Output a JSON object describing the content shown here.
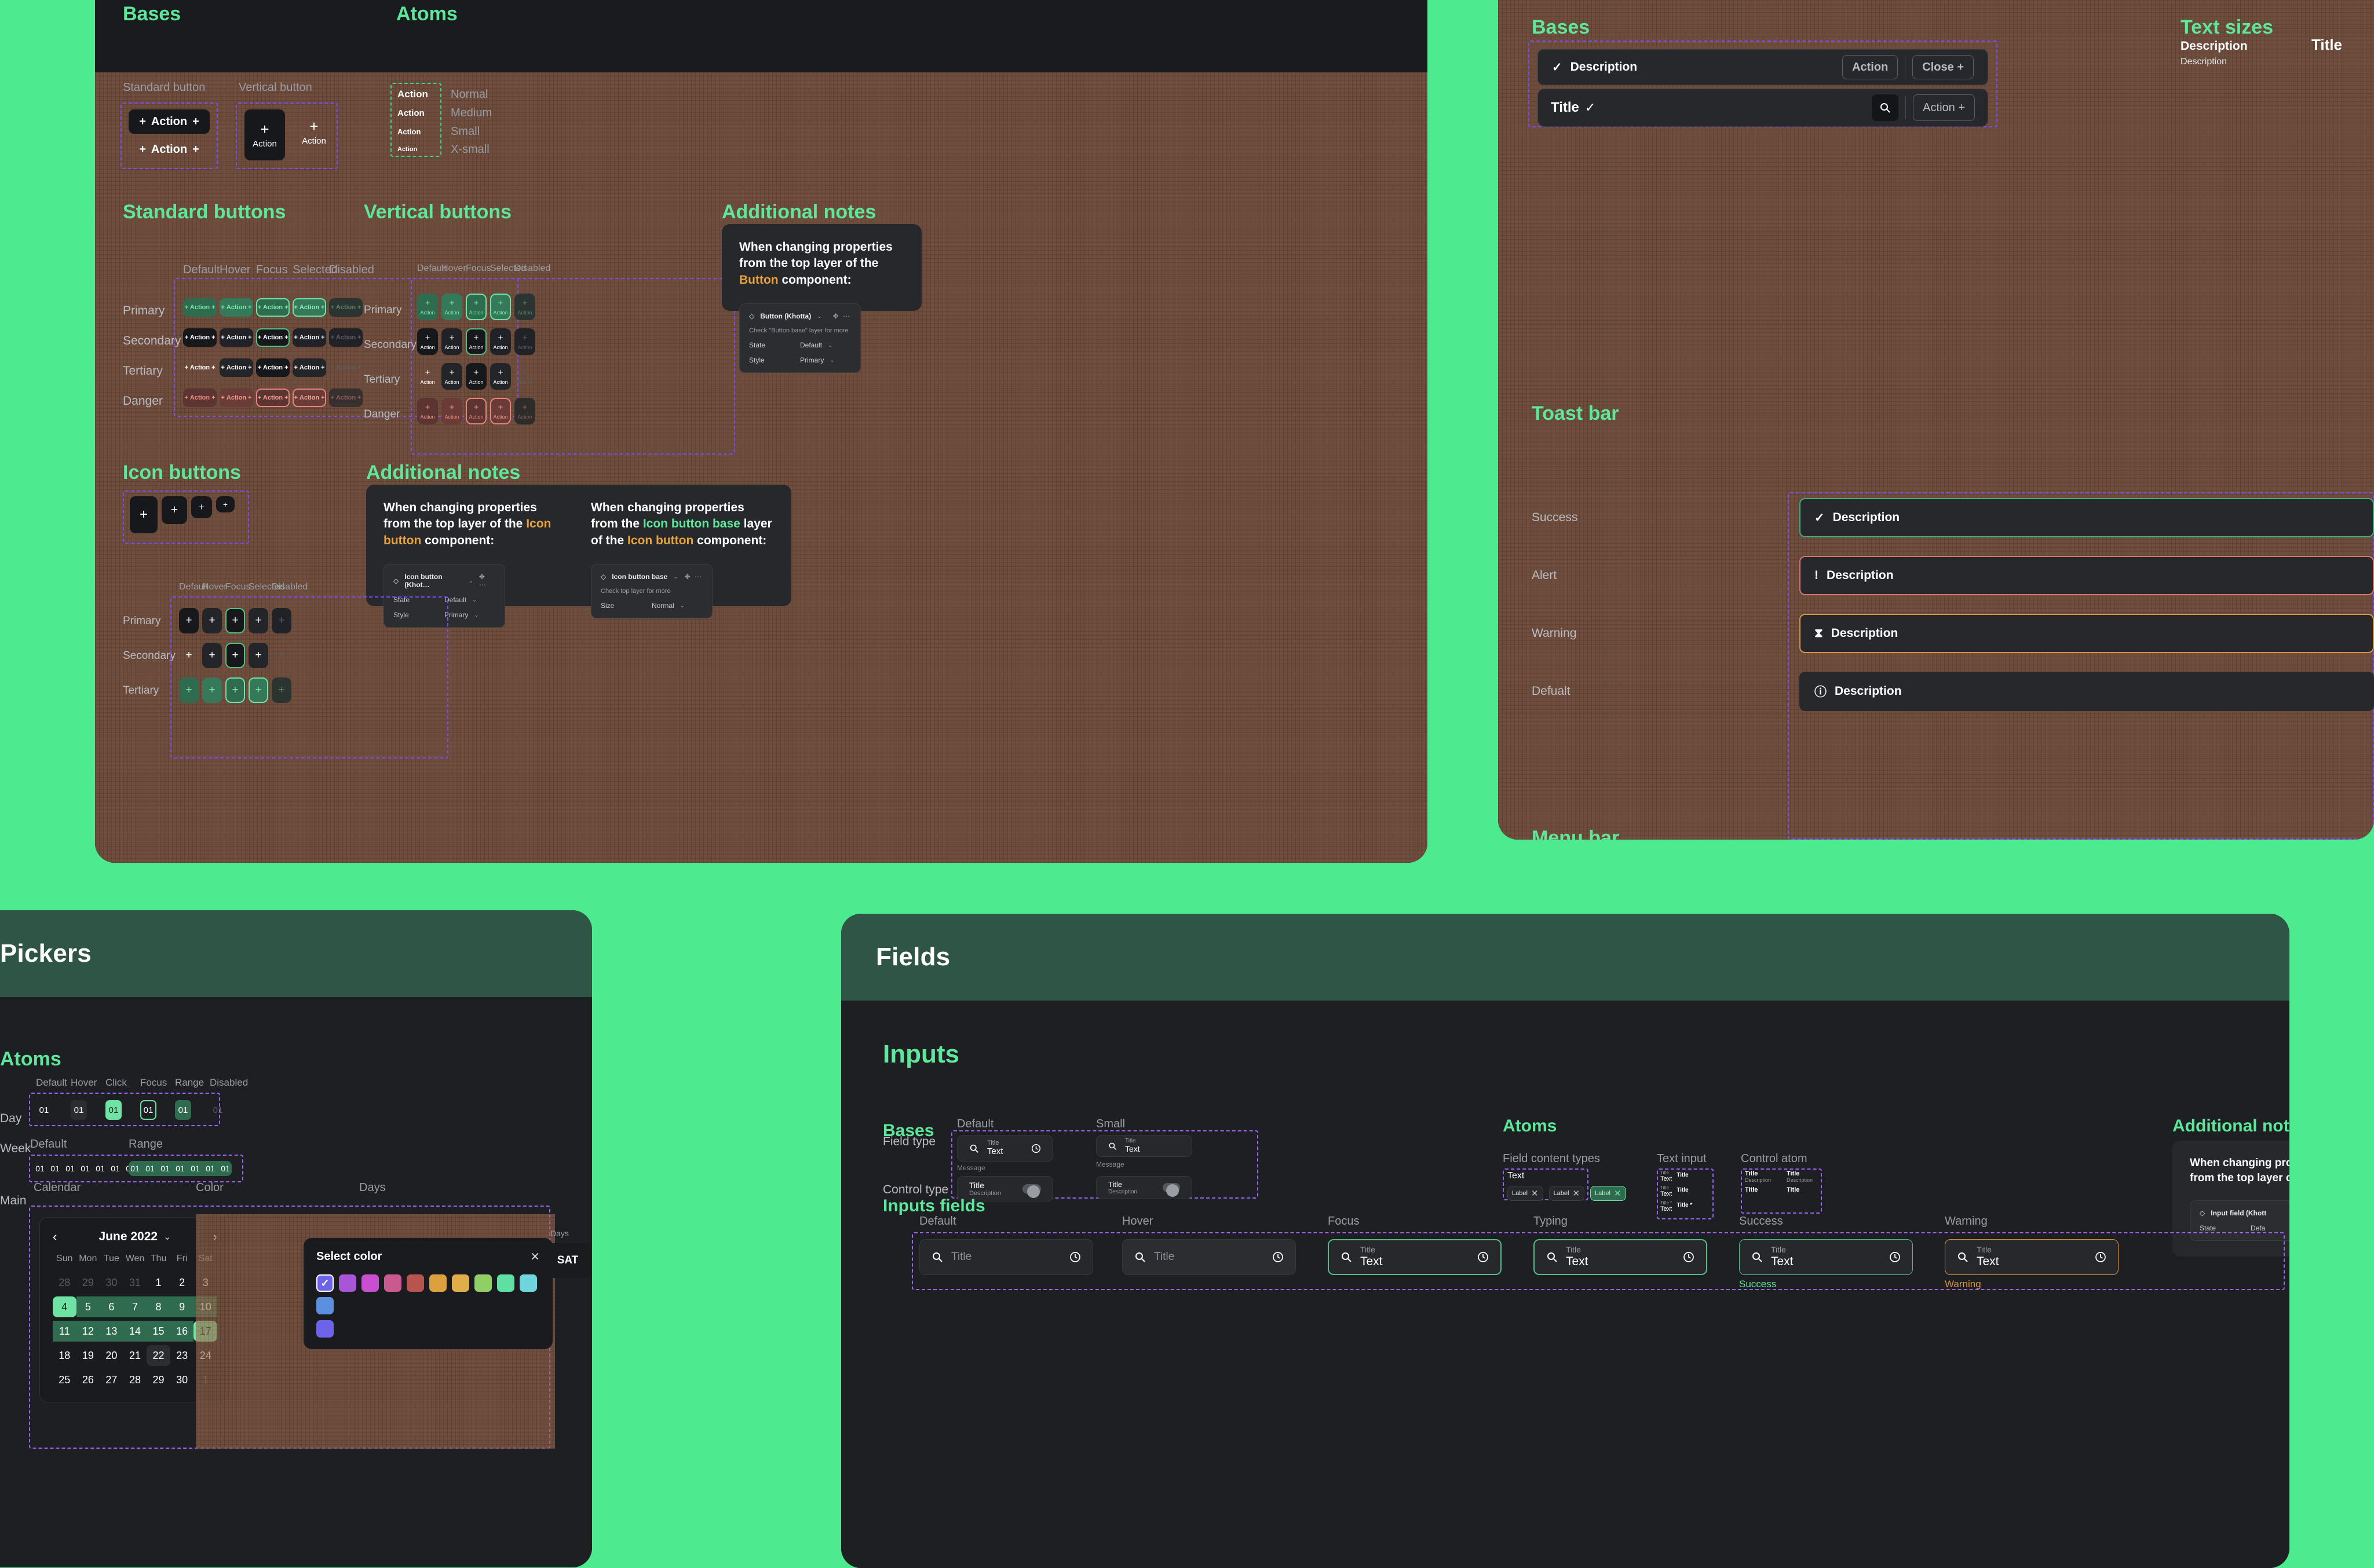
{
  "cards": {
    "buttons": {
      "title": ""
    },
    "topright": {
      "title": ""
    },
    "pickers": {
      "title": "Pickers"
    },
    "fields": {
      "title": "Fields"
    }
  },
  "buttons_card": {
    "sections": {
      "bases": "Bases",
      "atoms": "Atoms",
      "standard_buttons": "Standard buttons",
      "vertical_buttons": "Vertical buttons",
      "icon_buttons": "Icon buttons",
      "additional_notes": "Additional notes"
    },
    "bases": {
      "standard_label": "Standard button",
      "vertical_label": "Vertical button",
      "action": "Action",
      "plus": "+"
    },
    "atoms": {
      "items": [
        {
          "label": "Action",
          "size": "Normal"
        },
        {
          "label": "Action",
          "size": "Medium"
        },
        {
          "label": "Action",
          "size": "Small"
        },
        {
          "label": "Action",
          "size": "X-small"
        }
      ]
    },
    "state_columns": [
      "Default",
      "Hover",
      "Focus",
      "Selected",
      "Disabled"
    ],
    "style_rows": [
      "Primary",
      "Secondary",
      "Tertiary",
      "Danger"
    ],
    "icon_rows": [
      "Primary",
      "Secondary",
      "Tertiary"
    ],
    "action_label": "Action",
    "notes": [
      {
        "text_pre": "When changing properties from the top layer of the ",
        "accent": "Icon button",
        "text_post": " component:",
        "accent_color": "orange",
        "component": "Icon button (Khot…",
        "hint": "",
        "props": [
          {
            "name": "State",
            "value": "Default"
          },
          {
            "name": "Style",
            "value": "Primary"
          }
        ]
      },
      {
        "text_pre": "When changing properties from the ",
        "accent2": "Icon button base",
        "mid": " layer of the ",
        "accent": "Icon button",
        "text_post": " component:",
        "component": "Icon button base",
        "hint": "Check top layer for more",
        "props": [
          {
            "name": "Size",
            "value": "Normal"
          }
        ]
      }
    ],
    "button_note": {
      "text_pre": "When changing properties from the top layer of the ",
      "accent": "Button",
      "text_post": " component:",
      "component": "Button (Khotta)",
      "hint": "Check \"Button base\" layer for more",
      "props": [
        {
          "name": "State",
          "value": "Default"
        },
        {
          "name": "Style",
          "value": "Primary"
        }
      ]
    }
  },
  "topright_card": {
    "sections": {
      "bases": "Bases",
      "text_sizes": "Text sizes",
      "toast_bar": "Toast bar",
      "menu_bar": "Menu bar"
    },
    "bases": {
      "toast": {
        "description": "Description",
        "action": "Action",
        "close": "Close +"
      },
      "menu": {
        "title": "Title",
        "action": "Action +"
      }
    },
    "text_sizes": {
      "col1": "Description",
      "col2": "Title",
      "items": [
        "Description",
        "Description"
      ]
    },
    "toast_rows": [
      {
        "label": "Success",
        "icon": "✓",
        "text": "Description",
        "variant": "success"
      },
      {
        "label": "Alert",
        "icon": "!",
        "text": "Description",
        "variant": "alert"
      },
      {
        "label": "Warning",
        "icon": "⧗",
        "text": "Description",
        "variant": "warning"
      },
      {
        "label": "Defualt",
        "icon": "ⓘ",
        "text": "Description",
        "variant": "default"
      }
    ]
  },
  "pickers_card": {
    "sections": {
      "atoms": "Atoms"
    },
    "day": {
      "row_label": "Day",
      "columns": [
        "Default",
        "Hover",
        "Click",
        "Focus",
        "Range",
        "Disabled"
      ],
      "value": "01"
    },
    "week": {
      "row_label": "Week",
      "columns": [
        "Default",
        "Range"
      ],
      "value": "01",
      "count": 7
    },
    "main": {
      "row_label": "Main",
      "columns": [
        "Calendar",
        "Color",
        "Days"
      ]
    },
    "calendar": {
      "month": "June 2022",
      "prev": "‹",
      "next": "›",
      "chevron": "⌄",
      "dow": [
        "Sun",
        "Mon",
        "Tue",
        "Wen",
        "Thu",
        "Fri",
        "Sat"
      ],
      "weeks": [
        [
          {
            "d": "28",
            "s": "mute"
          },
          {
            "d": "29",
            "s": "mute"
          },
          {
            "d": "30",
            "s": "mute"
          },
          {
            "d": "31",
            "s": "mute"
          },
          {
            "d": "1",
            "s": ""
          },
          {
            "d": "2",
            "s": ""
          },
          {
            "d": "3",
            "s": ""
          }
        ],
        [
          {
            "d": "4",
            "s": "edge"
          },
          {
            "d": "5",
            "s": "inrange"
          },
          {
            "d": "6",
            "s": "inrange"
          },
          {
            "d": "7",
            "s": "inrange"
          },
          {
            "d": "8",
            "s": "inrange"
          },
          {
            "d": "9",
            "s": "inrange"
          },
          {
            "d": "10",
            "s": "inrange"
          }
        ],
        [
          {
            "d": "11",
            "s": "inrange"
          },
          {
            "d": "12",
            "s": "inrange"
          },
          {
            "d": "13",
            "s": "inrange"
          },
          {
            "d": "14",
            "s": "inrange"
          },
          {
            "d": "15",
            "s": "inrange"
          },
          {
            "d": "16",
            "s": "inrange"
          },
          {
            "d": "17",
            "s": "edge"
          }
        ],
        [
          {
            "d": "18",
            "s": ""
          },
          {
            "d": "19",
            "s": ""
          },
          {
            "d": "20",
            "s": ""
          },
          {
            "d": "21",
            "s": ""
          },
          {
            "d": "22",
            "s": "boxed"
          },
          {
            "d": "23",
            "s": ""
          },
          {
            "d": "24",
            "s": ""
          }
        ],
        [
          {
            "d": "25",
            "s": ""
          },
          {
            "d": "26",
            "s": ""
          },
          {
            "d": "27",
            "s": ""
          },
          {
            "d": "28",
            "s": ""
          },
          {
            "d": "29",
            "s": ""
          },
          {
            "d": "30",
            "s": ""
          },
          {
            "d": "1",
            "s": "mute"
          }
        ]
      ]
    },
    "color_picker": {
      "title": "Select color",
      "close": "✕",
      "check": "✓",
      "swatches": [
        "#6c63e8",
        "#a855d8",
        "#c94fd1",
        "#c85a8f",
        "#b8544f",
        "#dda03f",
        "#dfae4a",
        "#8fcf63",
        "#5fe0a2",
        "#6fd4dd",
        "#5b8fe0"
      ],
      "selected_index": 0,
      "extra_swatch": "#6c63e8"
    },
    "days": {
      "caption": "Days",
      "value": "SAT"
    }
  },
  "fields_card": {
    "sections": {
      "inputs": "Inputs",
      "bases": "Bases",
      "atoms": "Atoms",
      "additional": "Additional notes",
      "inputs_fields": "Inputs fields"
    },
    "bases": {
      "size_columns": [
        "Default",
        "Small"
      ],
      "row_labels": [
        "Field type",
        "Control type"
      ],
      "field": {
        "title": "Title",
        "text": "Text",
        "message": "Message"
      },
      "control": {
        "title": "Title",
        "description": "Description"
      }
    },
    "atoms": {
      "groups": [
        "Field content types",
        "Text input",
        "Control atom"
      ],
      "content_text": "Text",
      "chips": [
        {
          "label": "Label",
          "x": "✕",
          "active": false
        },
        {
          "label": "Label",
          "x": "✕",
          "active": false
        },
        {
          "label": "Label",
          "x": "✕",
          "active": true
        }
      ],
      "text_input": [
        {
          "small": "Title",
          "big": "Text",
          "right": "Title"
        },
        {
          "small": "Title",
          "big": "Text",
          "right": "Title"
        },
        {
          "small": "Title *",
          "big": "Text",
          "right": "Title *"
        }
      ],
      "control_atom": [
        {
          "title": "Title",
          "description": "Description"
        },
        {
          "title": "Title",
          "description": "Description"
        },
        {
          "title": "Title",
          "description": ""
        },
        {
          "title": "Title",
          "description": ""
        }
      ]
    },
    "note": {
      "text_pre": "When changing properties from the top layer of the ",
      "component": "Input field (Khott",
      "props": [
        {
          "name": "State",
          "value": "Defa"
        }
      ]
    },
    "inputs_fields": {
      "columns": [
        "Default",
        "Hover",
        "Focus",
        "Typing",
        "Success",
        "Warning"
      ],
      "placeholder": "Title",
      "title": "Title",
      "text": "Text",
      "messages": {
        "success": "Success",
        "warning": "Warning"
      }
    }
  },
  "icons": {
    "search": "search-icon",
    "clock": "clock-icon",
    "plus": "+",
    "check": "✓",
    "close": "✕"
  }
}
